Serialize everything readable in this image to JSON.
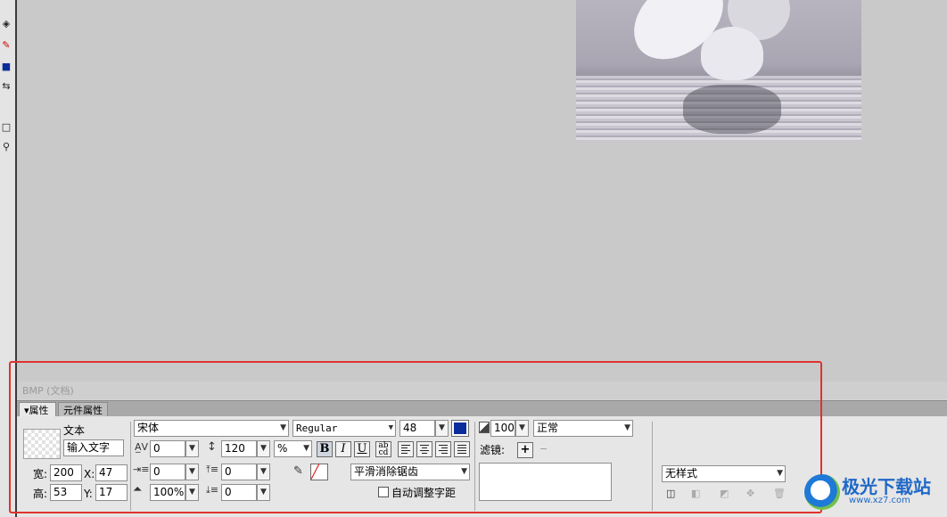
{
  "doc_title": "BMP (文档)",
  "tabs": [
    {
      "label": "属性"
    },
    {
      "label": "元件属性"
    }
  ],
  "text_tool": {
    "name_label": "文本",
    "name_value": "输入文字"
  },
  "font": {
    "family": "宋体",
    "style": "Regular",
    "size": "48",
    "color": "#0b2c9b"
  },
  "kerning": {
    "value": "0"
  },
  "leading": {
    "value": "120",
    "unit": "%"
  },
  "format_buttons": {
    "bold": "B",
    "italic": "I",
    "underline": "U"
  },
  "opacity": {
    "value": "100"
  },
  "blend_mode": "正常",
  "filter_label": "滤镜:",
  "filter_add": "+",
  "dimensions": {
    "width_label": "宽:",
    "width": "200",
    "x_label": "X:",
    "x": "47",
    "height_label": "高:",
    "height": "53",
    "y_label": "Y:",
    "y": "17"
  },
  "indent": {
    "value": "0"
  },
  "space_before": {
    "value": "0"
  },
  "scale": {
    "value": "100%"
  },
  "space_after": {
    "value": "0"
  },
  "antialias": "平滑消除锯齿",
  "auto_kern_label": "自动调整字距",
  "style_select": "无样式",
  "watermark": {
    "text": "极光下载站",
    "url": "www.xz7.com"
  }
}
